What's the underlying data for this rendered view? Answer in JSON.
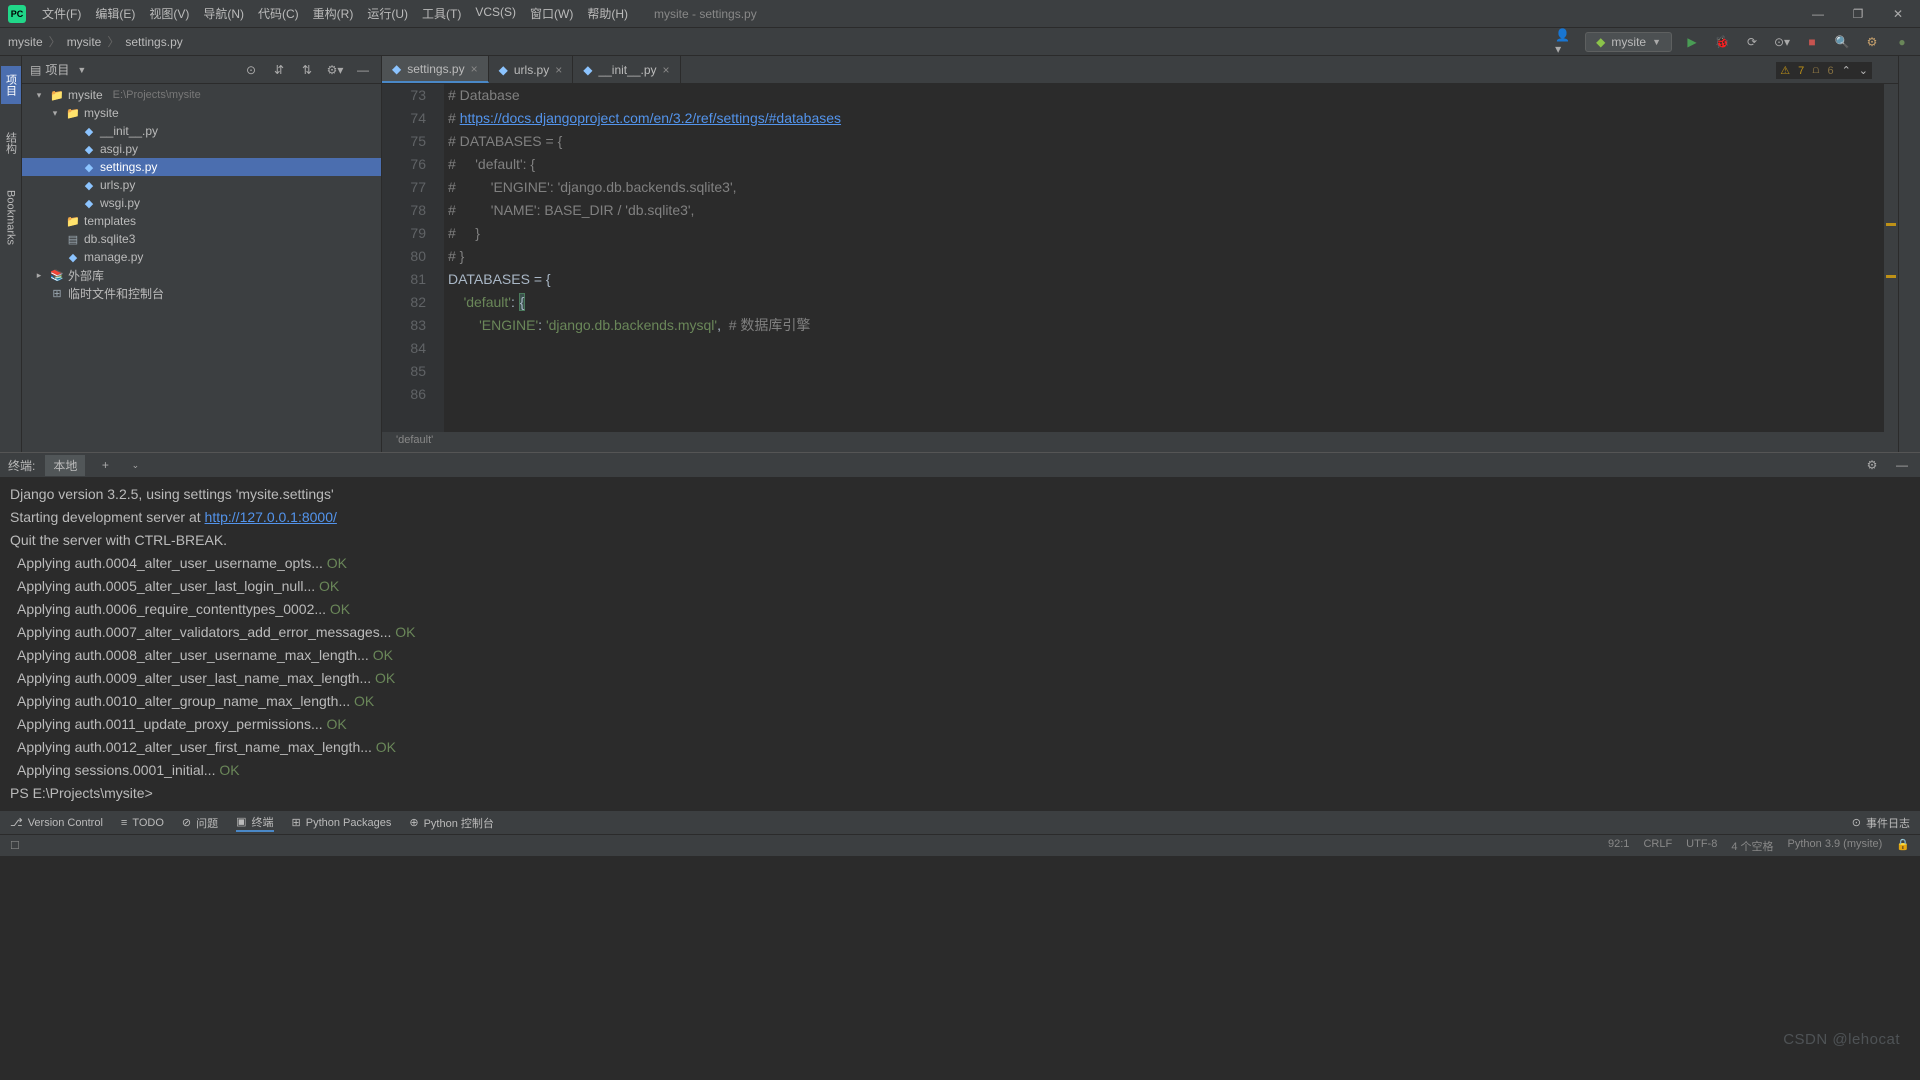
{
  "window": {
    "title": "mysite - settings.py"
  },
  "menu": [
    "文件(F)",
    "编辑(E)",
    "视图(V)",
    "导航(N)",
    "代码(C)",
    "重构(R)",
    "运行(U)",
    "工具(T)",
    "VCS(S)",
    "窗口(W)",
    "帮助(H)"
  ],
  "breadcrumb": [
    "mysite",
    "mysite",
    "settings.py"
  ],
  "run_config": "mysite",
  "project_panel": {
    "title": "项目",
    "tree": [
      {
        "d": 0,
        "arrow": "▾",
        "icon": "📁",
        "label": "mysite",
        "dim": "E:\\Projects\\mysite",
        "sel": false
      },
      {
        "d": 1,
        "arrow": "▾",
        "icon": "📁",
        "label": "mysite",
        "dim": "",
        "sel": false
      },
      {
        "d": 2,
        "arrow": "",
        "icon": "py",
        "label": "__init__.py",
        "dim": "",
        "sel": false
      },
      {
        "d": 2,
        "arrow": "",
        "icon": "py",
        "label": "asgi.py",
        "dim": "",
        "sel": false
      },
      {
        "d": 2,
        "arrow": "",
        "icon": "py",
        "label": "settings.py",
        "dim": "",
        "sel": true
      },
      {
        "d": 2,
        "arrow": "",
        "icon": "py",
        "label": "urls.py",
        "dim": "",
        "sel": false
      },
      {
        "d": 2,
        "arrow": "",
        "icon": "py",
        "label": "wsgi.py",
        "dim": "",
        "sel": false
      },
      {
        "d": 1,
        "arrow": "",
        "icon": "📁",
        "label": "templates",
        "dim": "",
        "sel": false
      },
      {
        "d": 1,
        "arrow": "",
        "icon": "▤",
        "label": "db.sqlite3",
        "dim": "",
        "sel": false
      },
      {
        "d": 1,
        "arrow": "",
        "icon": "py",
        "label": "manage.py",
        "dim": "",
        "sel": false
      },
      {
        "d": 0,
        "arrow": "▸",
        "icon": "📚",
        "label": "外部库",
        "dim": "",
        "sel": false
      },
      {
        "d": 0,
        "arrow": "",
        "icon": "⊞",
        "label": "临时文件和控制台",
        "dim": "",
        "sel": false
      }
    ]
  },
  "tabs": [
    {
      "label": "settings.py",
      "active": true
    },
    {
      "label": "urls.py",
      "active": false
    },
    {
      "label": "__init__.py",
      "active": false
    }
  ],
  "inspection": {
    "warn": "7",
    "weak": "6"
  },
  "code_start": 73,
  "code_lines": [
    {
      "t": ""
    },
    {
      "t": "# Database",
      "cls": "c-comment"
    },
    {
      "t": "# ",
      "cls": "c-comment",
      "link": "https://docs.djangoproject.com/en/3.2/ref/settings/#databases"
    },
    {
      "t": ""
    },
    {
      "t": "# DATABASES = {",
      "cls": "c-comment"
    },
    {
      "t": "#     'default': {",
      "cls": "c-comment"
    },
    {
      "t": "#         'ENGINE': 'django.db.backends.sqlite3',",
      "cls": "c-comment"
    },
    {
      "t": "#         'NAME': BASE_DIR / 'db.sqlite3',",
      "cls": "c-comment"
    },
    {
      "t": "#     }",
      "cls": "c-comment"
    },
    {
      "t": "# }",
      "cls": "c-comment"
    },
    {
      "t": ""
    },
    {
      "t": "DATABASES = {",
      "cls": ""
    },
    {
      "t": "    'default': {",
      "cls": "",
      "hl85": true
    },
    {
      "t": "        'ENGINE': 'django.db.backends.mysql',  # 数据库引擎",
      "cls": "",
      "engine": true
    }
  ],
  "code_breadcrumb": "'default'",
  "left_tabs": [
    "项目",
    "结构",
    "Bookmarks"
  ],
  "terminal": {
    "title": "终端:",
    "tab": "本地",
    "lines": [
      {
        "t": "Django version 3.2.5, using settings 'mysite.settings'"
      },
      {
        "t": "Starting development server at ",
        "url": "http://127.0.0.1:8000/"
      },
      {
        "t": "Quit the server with CTRL-BREAK."
      },
      {
        "t": "  Applying auth.0004_alter_user_username_opts... ",
        "ok": "OK"
      },
      {
        "t": "  Applying auth.0005_alter_user_last_login_null... ",
        "ok": "OK"
      },
      {
        "t": "  Applying auth.0006_require_contenttypes_0002... ",
        "ok": "OK"
      },
      {
        "t": "  Applying auth.0007_alter_validators_add_error_messages... ",
        "ok": "OK"
      },
      {
        "t": "  Applying auth.0008_alter_user_username_max_length... ",
        "ok": "OK"
      },
      {
        "t": "  Applying auth.0009_alter_user_last_name_max_length... ",
        "ok": "OK"
      },
      {
        "t": "  Applying auth.0010_alter_group_name_max_length... ",
        "ok": "OK"
      },
      {
        "t": "  Applying auth.0011_update_proxy_permissions... ",
        "ok": "OK"
      },
      {
        "t": "  Applying auth.0012_alter_user_first_name_max_length... ",
        "ok": "OK"
      },
      {
        "t": "  Applying sessions.0001_initial... ",
        "ok": "OK"
      },
      {
        "t": "PS E:\\Projects\\mysite> "
      }
    ]
  },
  "bottom_tools": [
    {
      "icon": "⎇",
      "label": "Version Control"
    },
    {
      "icon": "≡",
      "label": "TODO"
    },
    {
      "icon": "⊘",
      "label": "问题"
    },
    {
      "icon": "▣",
      "label": "终端",
      "active": true
    },
    {
      "icon": "⊞",
      "label": "Python Packages"
    },
    {
      "icon": "⊕",
      "label": "Python 控制台"
    }
  ],
  "status": {
    "pos": "92:1",
    "sep": "CRLF",
    "enc": "UTF-8",
    "indent": "4 个空格",
    "python": "Python 3.9 (mysite)"
  },
  "right_hint": "事件日志",
  "watermark": "CSDN @lehocat"
}
